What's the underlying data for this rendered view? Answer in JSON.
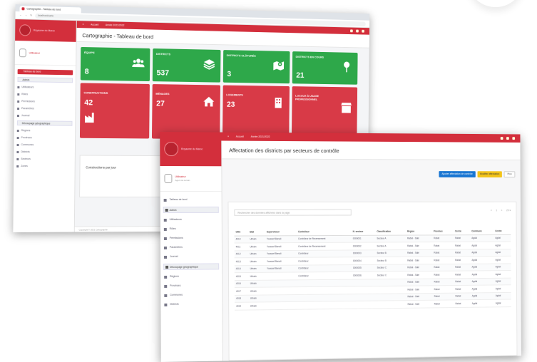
{
  "browser": {
    "tab_title": "Cartographie - Tableau de bord",
    "url": "localhost/carto"
  },
  "colors": {
    "brand": "#d32f3c",
    "green": "#2ea84a",
    "card_red": "#d83a47",
    "blue": "#1976d2",
    "yellow": "#f3c419"
  },
  "dashboard": {
    "topbar": {
      "home": "Accueil",
      "link": "Année 2021/2022"
    },
    "logo_text": "Royaume du Maroc",
    "user": "Utilisateur",
    "sidebar": {
      "active_section": "Tableau de bord",
      "group1": "Admin",
      "items1": [
        "Utilisateurs",
        "Rôles",
        "Permissions",
        "Paramètres",
        "Journal"
      ],
      "group2": "Découpage géographique",
      "items2": [
        "Régions",
        "Provinces",
        "Communes",
        "Districts",
        "Secteurs",
        "Zones"
      ]
    },
    "title": "Cartographie - Tableau de bord",
    "cards": [
      {
        "label": "ÉQUIPE",
        "value": "8",
        "icon": "users-icon",
        "color": "green"
      },
      {
        "label": "DISTRICTS",
        "value": "537",
        "icon": "layers-icon",
        "color": "green"
      },
      {
        "label": "DISTRICTS CLÔTURÉS",
        "value": "3",
        "icon": "map-marker-icon",
        "color": "green"
      },
      {
        "label": "DISTRICTS EN COURS",
        "value": "21",
        "icon": "pin-icon",
        "color": "green"
      },
      {
        "label": "CONSTRUCTIONS",
        "value": "42",
        "icon": "factory-icon",
        "color": "red"
      },
      {
        "label": "MÉNAGES",
        "value": "27",
        "icon": "home-icon",
        "color": "red"
      },
      {
        "label": "LOGEMENTS",
        "value": "23",
        "icon": "building-icon",
        "color": "red"
      },
      {
        "label": "LOCAUX À USAGE PROFESSIONNEL",
        "value": "",
        "icon": "shop-icon",
        "color": "red"
      }
    ],
    "panel": "Constructions par jour",
    "footer": "Copyright © 2021 Cartographie"
  },
  "affectation": {
    "topbar": {
      "home": "Accueil",
      "link": "Année 2021/2022"
    },
    "logo_text": "Royaume du Maroc",
    "user": "Utilisateur",
    "user_role": "Agent de terrain",
    "sidebar": {
      "active_section": "Tableau de bord",
      "group1": "Admin",
      "items1": [
        "Utilisateurs",
        "Rôles",
        "Permissions",
        "Paramètres",
        "Journal"
      ],
      "group2": "Découpage géographique",
      "items2": [
        "Régions",
        "Provinces",
        "Communes",
        "Districts"
      ]
    },
    "title": "Affectation des districts par secteurs de contrôle",
    "buttons": {
      "add": "Ajouter affectation de contrôle",
      "edit": "Modifier affectation",
      "more": "Plus"
    },
    "search_placeholder": "Rechercher des données affichées dans la page",
    "pager": [
      "«",
      "1",
      "»",
      "20 ▾"
    ],
    "columns": [
      "CRC",
      "Etat",
      "Superviseur",
      "Contrôleur",
      "N. secteur",
      "Classification",
      "Région",
      "Province",
      "Cercle",
      "Commune",
      "Centre"
    ],
    "rows": [
      [
        "4010",
        "Urbain",
        "Youssef Benali",
        "Contrôleur de Recensement",
        "0000001",
        "Secteur A",
        "Rabat - Salé",
        "Rabat",
        "Rabat",
        "Agdal",
        "Agdal"
      ],
      [
        "4011",
        "Urbain",
        "Youssef Benali",
        "Contrôleur de Recensement",
        "0000002",
        "Secteur A",
        "Rabat - Salé",
        "Rabat",
        "Rabat",
        "Agdal",
        "Agdal"
      ],
      [
        "4012",
        "Urbain",
        "Youssef Benali",
        "Contrôleur",
        "0000003",
        "Secteur B",
        "Rabat - Salé",
        "Rabat",
        "Rabat",
        "Agdal",
        "Agdal"
      ],
      [
        "4013",
        "Urbain",
        "Youssef Benali",
        "Contrôleur",
        "0000004",
        "Secteur B",
        "Rabat - Salé",
        "Rabat",
        "Rabat",
        "Agdal",
        "Agdal"
      ],
      [
        "4014",
        "Urbain",
        "Youssef Benali",
        "Contrôleur",
        "0000005",
        "Secteur C",
        "Rabat - Salé",
        "Rabat",
        "Rabat",
        "Agdal",
        "Agdal"
      ],
      [
        "4015",
        "Urbain",
        "",
        "Contrôleur",
        "0000006",
        "Secteur C",
        "Rabat - Salé",
        "Rabat",
        "Rabat",
        "Agdal",
        "Agdal"
      ],
      [
        "4016",
        "Urbain",
        "",
        "",
        "",
        "",
        "Rabat - Salé",
        "Rabat",
        "Rabat",
        "Agdal",
        "Agdal"
      ],
      [
        "4017",
        "Urbain",
        "",
        "",
        "",
        "",
        "Rabat - Salé",
        "Rabat",
        "Rabat",
        "Agdal",
        "Agdal"
      ],
      [
        "4018",
        "Urbain",
        "",
        "",
        "",
        "",
        "Rabat - Salé",
        "Rabat",
        "Rabat",
        "Agdal",
        "Agdal"
      ],
      [
        "4019",
        "Urbain",
        "",
        "",
        "",
        "",
        "Rabat - Salé",
        "Rabat",
        "Rabat",
        "Agdal",
        "Agdal"
      ]
    ]
  }
}
